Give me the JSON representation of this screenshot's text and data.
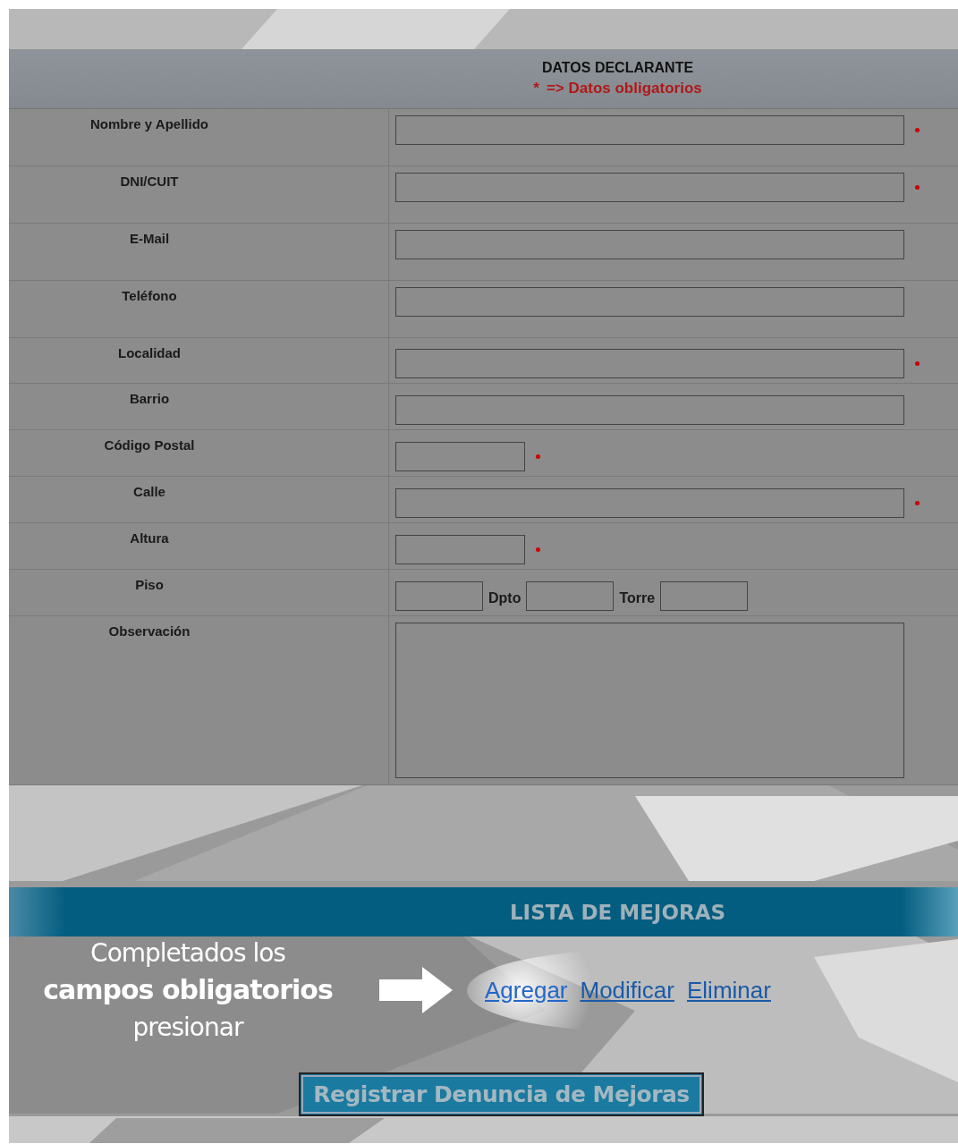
{
  "form": {
    "title": "DATOS DECLARANTE",
    "required_note_mark": "*",
    "required_note": "=> Datos obligatorios",
    "fields": [
      {
        "kind": "text",
        "label": "Nombre y Apellido",
        "required": true
      },
      {
        "kind": "text",
        "label": "DNI/CUIT",
        "required": true
      },
      {
        "kind": "text",
        "label": "E-Mail",
        "required": false
      },
      {
        "kind": "text",
        "label": "Teléfono",
        "required": false
      },
      {
        "kind": "text",
        "label": "Localidad",
        "required": true
      },
      {
        "kind": "text",
        "label": "Barrio",
        "required": false
      },
      {
        "kind": "short",
        "label": "Código Postal",
        "required": true
      },
      {
        "kind": "text",
        "label": "Calle",
        "required": true
      },
      {
        "kind": "short",
        "label": "Altura",
        "required": true
      },
      {
        "kind": "split",
        "label": "Piso",
        "required": false,
        "parts": [
          "Dpto",
          "Torre"
        ]
      },
      {
        "kind": "textarea",
        "label": "Observación",
        "required": false
      }
    ]
  },
  "mejoras": {
    "title": "LISTA DE MEJORAS",
    "hint_lines": [
      "Completados los",
      "**campos obligatorios**",
      "presionar"
    ],
    "links": [
      "Agregar",
      "Modificar",
      "Eliminar"
    ],
    "button": "Registrar Denuncia de Mejoras"
  }
}
